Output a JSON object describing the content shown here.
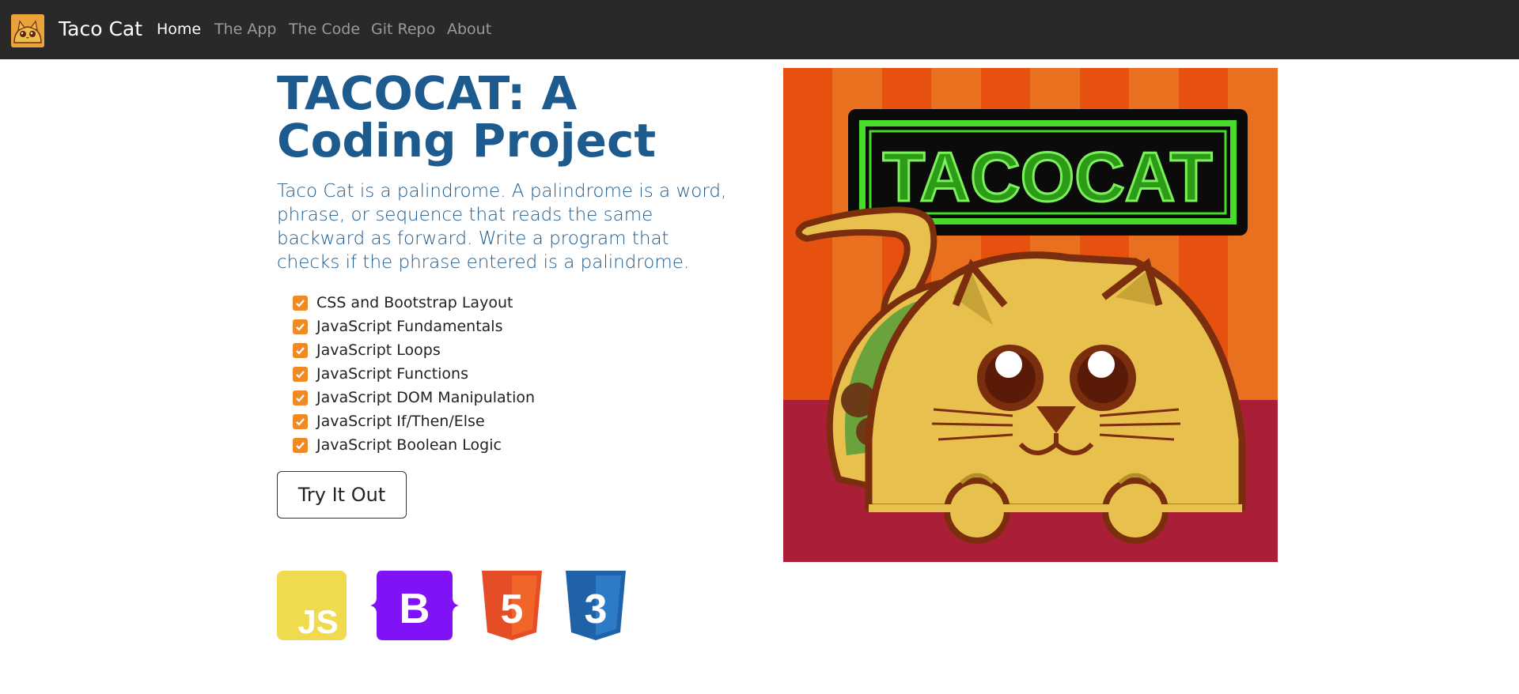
{
  "navbar": {
    "brand": "Taco Cat",
    "links": [
      "Home",
      "The App",
      "The Code",
      "Git Repo",
      "About"
    ],
    "active_index": 0
  },
  "hero": {
    "title": "TACOCAT: A Coding Project",
    "lead": "Taco Cat is a palindrome. A palindrome is a word, phrase, or sequence that reads the same backward as forward. Write a program that checks if the phrase entered is a palindrome.",
    "features": [
      "CSS and Bootstrap Layout",
      "JavaScript Fundamentals",
      "JavaScript Loops",
      "JavaScript Functions",
      "JavaScript DOM Manipulation",
      "JavaScript If/Then/Else",
      "JavaScript Boolean Logic"
    ],
    "button_label": "Try It Out"
  },
  "tech_icons": {
    "js": "JS",
    "bootstrap": "B",
    "html": "5",
    "css": "3"
  },
  "sign_text": "TACOCAT",
  "colors": {
    "navbar_bg": "#292929",
    "title": "#1d5a8e",
    "check": "#f08a24",
    "js": "#f0db4f",
    "bootstrap": "#7f13f6",
    "html": "#e44d26",
    "css": "#1f62a8"
  },
  "icons": [
    "taco-cat-logo-icon",
    "checkbox-checked-icon",
    "javascript-logo-icon",
    "bootstrap-logo-icon",
    "html5-logo-icon",
    "css3-logo-icon"
  ]
}
